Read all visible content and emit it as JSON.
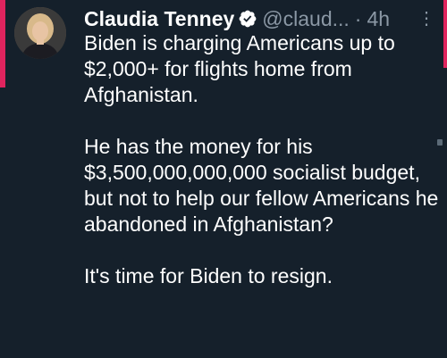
{
  "colors": {
    "background": "#15202b",
    "text_primary": "#ffffff",
    "text_secondary": "#8b98a5",
    "accent": "#e0245e",
    "verified_badge": "#ffffff"
  },
  "tweet": {
    "author": {
      "display_name": "Claudia Tenney",
      "handle": "@claud...",
      "verified_icon": "verified-badge-icon",
      "avatar_icon": "profile-photo"
    },
    "separator": "·",
    "timestamp": "4h",
    "more_icon": "more-options-icon",
    "more_label": "⋮",
    "paragraphs": [
      "Biden is charging Americans up to $2,000+ for flights home from Afghanistan.",
      "He has the money for his $3,500,000,000,000 socialist budget, but not to help our fellow Americans he abandoned in Afghanistan?",
      "It's time for Biden to resign."
    ]
  }
}
